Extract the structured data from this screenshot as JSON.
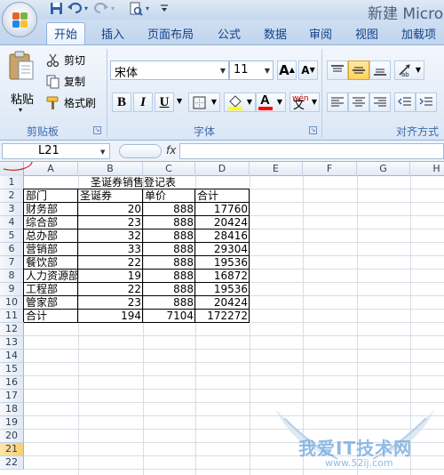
{
  "window": {
    "title": "新建 Micro"
  },
  "tabs": [
    {
      "label": "开始",
      "active": true
    },
    {
      "label": "插入"
    },
    {
      "label": "页面布局"
    },
    {
      "label": "公式"
    },
    {
      "label": "数据"
    },
    {
      "label": "审阅"
    },
    {
      "label": "视图"
    },
    {
      "label": "加载项"
    }
  ],
  "ribbon": {
    "clipboard": {
      "group_label": "剪贴板",
      "paste": "粘贴",
      "cut": "剪切",
      "copy": "复制",
      "format_painter": "格式刷"
    },
    "font": {
      "group_label": "字体",
      "font_name": "宋体",
      "font_size": "11",
      "bold": "B",
      "italic": "I",
      "underline": "U",
      "grow": "A",
      "shrink": "A",
      "phonetic": "wén",
      "fill_color": "#ffff00",
      "font_color": "#ff0000"
    },
    "alignment": {
      "group_label": "对齐方式"
    }
  },
  "formula_bar": {
    "name_box": "L21",
    "fx": "fx",
    "formula": ""
  },
  "colors": {
    "accent": "#15428b",
    "ribbon_bg": "#dbe7f6",
    "highlight": "#ffd25c"
  },
  "sheet": {
    "columns": [
      "A",
      "B",
      "C",
      "D",
      "E",
      "F",
      "G",
      "H"
    ],
    "rows": [
      "1",
      "2",
      "3",
      "4",
      "5",
      "6",
      "7",
      "8",
      "9",
      "10",
      "11",
      "12",
      "13",
      "14",
      "15",
      "16",
      "17",
      "18",
      "19",
      "20",
      "21",
      "22"
    ],
    "title": "圣诞券销售登记表",
    "headers": [
      "部门",
      "圣诞券",
      "单价",
      "合计"
    ],
    "data": [
      [
        "财务部",
        "20",
        "888",
        "17760"
      ],
      [
        "综合部",
        "23",
        "888",
        "20424"
      ],
      [
        "总办部",
        "32",
        "888",
        "28416"
      ],
      [
        "营销部",
        "33",
        "888",
        "29304"
      ],
      [
        "餐饮部",
        "22",
        "888",
        "19536"
      ],
      [
        "人力资源部",
        "19",
        "888",
        "16872"
      ],
      [
        "工程部",
        "22",
        "888",
        "19536"
      ],
      [
        "管家部",
        "23",
        "888",
        "20424"
      ]
    ],
    "total": [
      "合计",
      "194",
      "7104",
      "172272"
    ]
  },
  "watermark": {
    "text": "我爱IT技术网",
    "url": "www.52ij.com"
  }
}
